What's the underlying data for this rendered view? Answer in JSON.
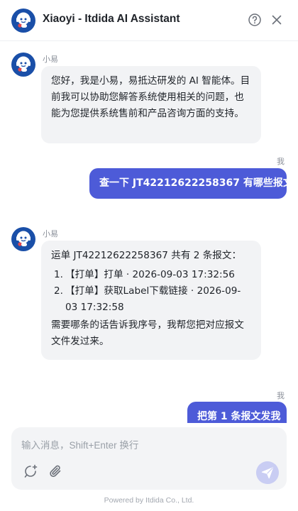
{
  "header": {
    "title": "Xiaoyi - Itdida AI Assistant",
    "icons": {
      "logo": "robot-avatar-icon",
      "help": "help-circle-icon",
      "close": "close-icon"
    }
  },
  "messages": [
    {
      "role": "assistant",
      "sender": "小易",
      "text": "您好，我是小易，易抵达研发的 AI 智能体。目前我可以协助您解答系统使用相关的问题，也能为您提供系统售前和产品咨询方面的支持。"
    },
    {
      "role": "user",
      "sender": "我",
      "text": "查一下 JT42212622258367 有哪些报文"
    },
    {
      "role": "assistant",
      "sender": "小易",
      "intro": "运单 JT42212622258367 共有 2 条报文：",
      "items": [
        {
          "num": "1.",
          "text": "【打单】打单 · 2026-09-03 17:32:56"
        },
        {
          "num": "2.",
          "text": "【打单】获取Label下载链接 · 2026-09-03 17:32:58"
        }
      ],
      "outro": "需要哪条的话告诉我序号，我帮您把对应报文文件发过来。"
    },
    {
      "role": "user",
      "sender": "我",
      "text": "把第 1 条报文发我"
    }
  ],
  "composer": {
    "placeholder": "输入消息，Shift+Enter 换行",
    "value": "",
    "icons": {
      "new_chat": "new-chat-icon",
      "attach": "paperclip-icon",
      "send": "send-icon"
    }
  },
  "footer": {
    "text": "Powered by Itdida Co., Ltd."
  },
  "colors": {
    "accent": "#4d5bd8",
    "avatar_blue": "#1a4fa8",
    "bot_bubble": "#f2f3f5",
    "send_disabled": "#c9cdf3"
  }
}
